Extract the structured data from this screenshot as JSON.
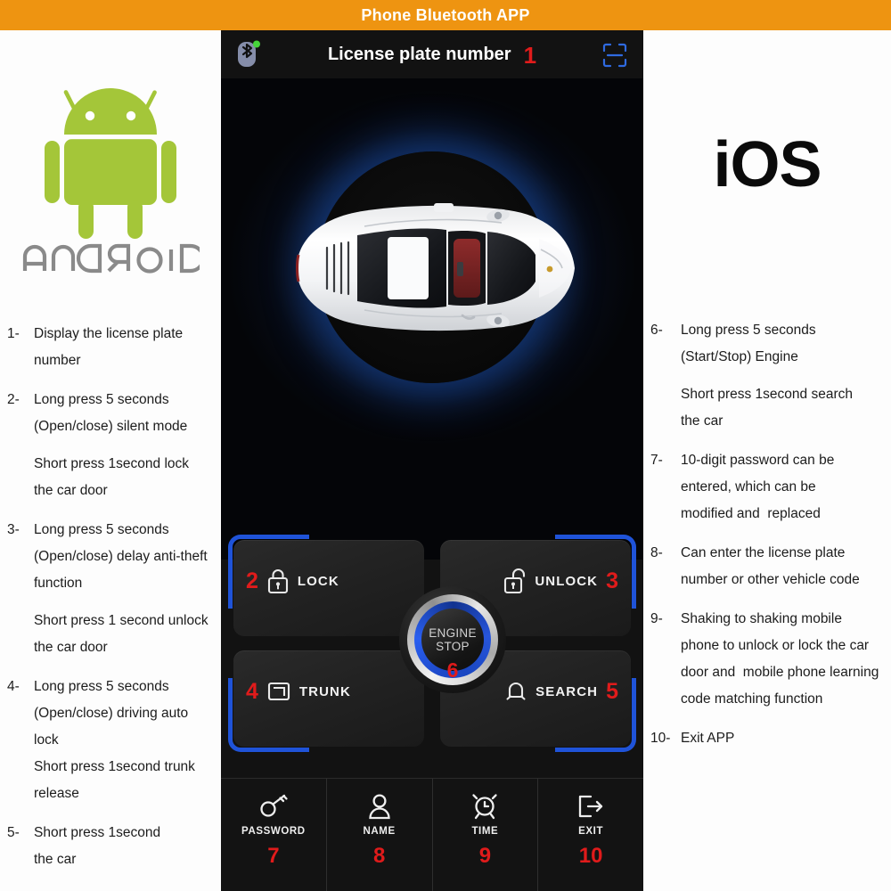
{
  "titlebar": {
    "title": "Phone Bluetooth APP",
    "bg_color": "#ee9411",
    "text_color": "#ffffff"
  },
  "platforms": {
    "android": {
      "wordmark": "android",
      "robot_color": "#A4C639",
      "wordmark_color": "#8a8a8a"
    },
    "ios": {
      "label": "iOS",
      "color": "#0b0b0b"
    }
  },
  "phone": {
    "header": {
      "bluetooth_icon": "bluetooth-icon",
      "title": "License plate number",
      "marker": "1",
      "scan_icon": "scan-frame-icon"
    },
    "stage": {
      "vehicle": "white-sports-car-top-view",
      "glow_color": "#1848a0"
    },
    "controls": [
      {
        "id": "lock",
        "icon": "lock-closed-icon",
        "label": "LOCK",
        "marker": "2",
        "marker_side": "left",
        "accent_corner": "top-left",
        "accent_color": "#1f53d8"
      },
      {
        "id": "unlock",
        "icon": "lock-open-icon",
        "label": "UNLOCK",
        "marker": "3",
        "marker_side": "right",
        "accent_corner": "top-right",
        "accent_color": "#1f53d8"
      },
      {
        "id": "trunk",
        "icon": "trunk-icon",
        "label": "TRUNK",
        "marker": "4",
        "marker_side": "left",
        "accent_corner": "bottom-left",
        "accent_color": "#1f53d8"
      },
      {
        "id": "search",
        "icon": "bell-icon",
        "label": "SEARCH",
        "marker": "5",
        "marker_side": "right",
        "accent_corner": "bottom-right",
        "accent_color": "#1f53d8"
      }
    ],
    "engine_button": {
      "line1": "ENGINE",
      "line2": "STOP",
      "marker": "6"
    },
    "toolbar": [
      {
        "id": "password",
        "icon": "key-icon",
        "label": "PASSWORD",
        "marker": "7"
      },
      {
        "id": "name",
        "icon": "person-icon",
        "label": "NAME",
        "marker": "8"
      },
      {
        "id": "time",
        "icon": "alarm-clock-icon",
        "label": "TIME",
        "marker": "9"
      },
      {
        "id": "exit",
        "icon": "exit-arrow-icon",
        "label": "EXIT",
        "marker": "10"
      }
    ],
    "marker_color": "#e01b1b"
  },
  "legend_left": [
    {
      "num": "1-",
      "lines": [
        "Display the license plate",
        "number"
      ]
    },
    {
      "num": "2-",
      "lines": [
        "Long press 5 seconds",
        "(Open/close) silent mode",
        "",
        "Short press 1second lock",
        "the car door"
      ]
    },
    {
      "num": "3-",
      "lines": [
        "Long press 5 seconds",
        "(Open/close) delay anti-theft",
        "function",
        "",
        "Short press 1 second unlock",
        "the car door"
      ]
    },
    {
      "num": "4-",
      "lines": [
        "Long press 5 seconds",
        "(Open/close) driving auto",
        "lock",
        "Short press 1second trunk",
        "release"
      ]
    },
    {
      "num": "5-",
      "lines": [
        "Short press 1second",
        "the car"
      ]
    }
  ],
  "legend_right": [
    {
      "num": "6-",
      "lines": [
        "Long press 5 seconds",
        "(Start/Stop) Engine",
        "",
        "Short press 1second search",
        "the car"
      ]
    },
    {
      "num": "7-",
      "lines": [
        "10-digit password can be",
        "entered, which can be",
        "modified and  replaced"
      ]
    },
    {
      "num": "8-",
      "lines": [
        "Can enter the license plate",
        "number or other vehicle code"
      ]
    },
    {
      "num": "9-",
      "lines": [
        "Shaking to shaking mobile",
        "phone to unlock or lock the car",
        "door and  mobile phone learning",
        "code matching function"
      ]
    },
    {
      "num": "10-",
      "lines": [
        "Exit APP"
      ]
    }
  ]
}
